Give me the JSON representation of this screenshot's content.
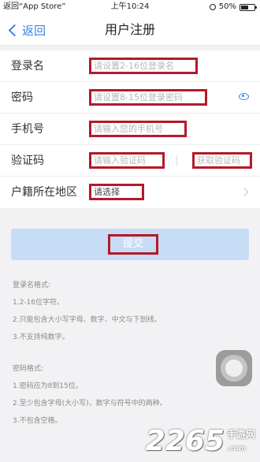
{
  "status_bar": {
    "left": "返回“App Store”",
    "time": "上午10:24",
    "battery": "50%"
  },
  "nav": {
    "back_label": "返回",
    "title": "用户注册"
  },
  "form": {
    "rows": [
      {
        "label": "登录名",
        "placeholder": "请设置2-16位登录名"
      },
      {
        "label": "密码",
        "placeholder": "请设置8-15位登录密码"
      },
      {
        "label": "手机号",
        "placeholder": "请输入您的手机号"
      },
      {
        "label": "验证码",
        "placeholder": "请输入验证码",
        "action": "获取验证码"
      },
      {
        "label": "户籍所在地区",
        "placeholder": "请选择"
      }
    ]
  },
  "submit_label": "提交",
  "rules": {
    "login_title": "登录名格式:",
    "login_items": [
      "1.2-16位字符。",
      "2.只能包含大小写字母、数字、中文与下划线。",
      "3.不支持纯数字。"
    ],
    "password_title": "密码格式:",
    "password_items": [
      "1.密码应为8到15位。",
      "2.至少包含字母(大小写)，数字与符号中的两种。",
      "3.不包含空格。"
    ]
  },
  "watermark": {
    "number": "2265",
    "site": "手游网",
    "domain": ".com"
  },
  "colors": {
    "accent": "#3b82e6",
    "highlight_box": "#b31a2a",
    "submit_bg": "#c7dcf5"
  },
  "icons": [
    "chevron-left-icon",
    "eye-icon",
    "chevron-right-icon",
    "alarm-icon",
    "battery-icon"
  ]
}
